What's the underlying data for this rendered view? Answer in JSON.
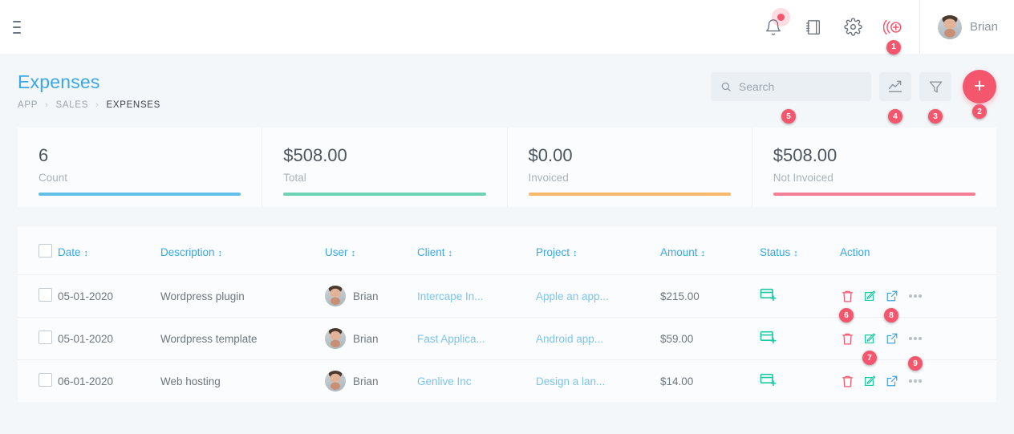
{
  "colors": {
    "accent_blue": "#39a8e8",
    "accent_red": "#f4576d",
    "bar_count": "#62c0e8",
    "bar_total": "#6ed3b4",
    "bar_invoiced": "#f7b86a",
    "bar_not_invoiced": "#f47f95",
    "status_teal": "#1dc9a4",
    "link_blue": "#7cc4ee",
    "page_bg": "#f4f7f9"
  },
  "topbar": {
    "menu_icon": "hamburger-icon",
    "icons": [
      {
        "name": "notifications-icon",
        "has_dot": true
      },
      {
        "name": "notebook-icon",
        "has_dot": false
      },
      {
        "name": "settings-gear-icon",
        "has_dot": false
      },
      {
        "name": "add-record-icon",
        "has_dot": false,
        "badge": "1"
      }
    ],
    "user": {
      "name": "Brian",
      "avatar": "user-avatar"
    }
  },
  "page": {
    "title": "Expenses",
    "breadcrumb": [
      {
        "label": "APP",
        "active": false
      },
      {
        "label": "SALES",
        "active": false
      },
      {
        "label": "EXPENSES",
        "active": true
      }
    ],
    "breadcrumb_sep": "›"
  },
  "search": {
    "value": "",
    "placeholder": "Search",
    "icon": "search-icon",
    "badge": "5"
  },
  "tools": [
    {
      "name": "chart-trend-button",
      "icon": "trending-up-icon",
      "badge": "4"
    },
    {
      "name": "filter-button",
      "icon": "filter-icon",
      "badge": "3"
    }
  ],
  "add_button": {
    "label": "+",
    "name": "add-expense-button",
    "badge": "2"
  },
  "stats": [
    {
      "value": "6",
      "label": "Count",
      "bar_color": "#62c0e8"
    },
    {
      "value": "$508.00",
      "label": "Total",
      "bar_color": "#6ed3b4"
    },
    {
      "value": "$0.00",
      "label": "Invoiced",
      "bar_color": "#f7b86a"
    },
    {
      "value": "$508.00",
      "label": "Not Invoiced",
      "bar_color": "#f47f95"
    }
  ],
  "table": {
    "sort_icon": "↕",
    "columns": [
      {
        "label": "Date",
        "sortable": true
      },
      {
        "label": "Description",
        "sortable": true
      },
      {
        "label": "User",
        "sortable": true
      },
      {
        "label": "Client",
        "sortable": true
      },
      {
        "label": "Project",
        "sortable": true
      },
      {
        "label": "Amount",
        "sortable": true
      },
      {
        "label": "Status",
        "sortable": true
      },
      {
        "label": "Action",
        "sortable": false
      }
    ],
    "rows": [
      {
        "date": "05-01-2020",
        "description": "Wordpress plugin",
        "user": "Brian",
        "client": "Intercape In...",
        "project": "Apple an app...",
        "amount": "$215.00",
        "status_icon": "card-add-icon",
        "badges": {
          "delete": "6",
          "edit": "",
          "open": "8",
          "more": ""
        }
      },
      {
        "date": "05-01-2020",
        "description": "Wordpress template",
        "user": "Brian",
        "client": "Fast Applica...",
        "project": "Android app...",
        "amount": "$59.00",
        "status_icon": "card-add-icon",
        "badges": {
          "delete": "",
          "edit": "7",
          "open": "",
          "more": "9"
        }
      },
      {
        "date": "06-01-2020",
        "description": "Web hosting",
        "user": "Brian",
        "client": "Genlive Inc",
        "project": "Design a lan...",
        "amount": "$14.00",
        "status_icon": "card-add-icon",
        "badges": {
          "delete": "",
          "edit": "",
          "open": "",
          "more": ""
        }
      }
    ],
    "action_icons": {
      "delete": "trash-icon",
      "edit": "edit-pencil-icon",
      "open": "external-link-icon",
      "more": "more-options-icon"
    }
  }
}
